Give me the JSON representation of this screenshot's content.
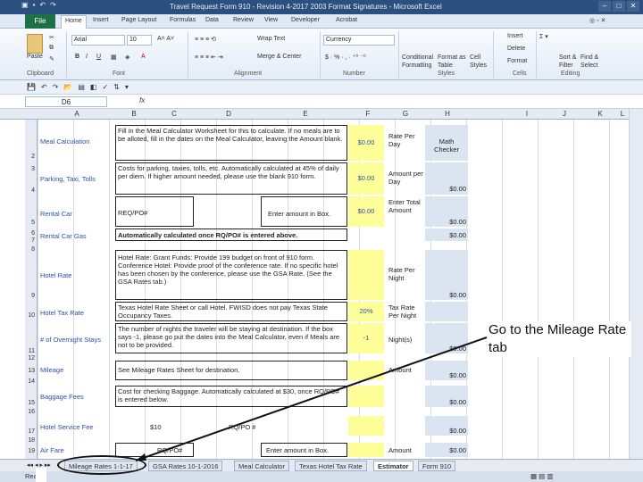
{
  "window": {
    "title": "Travel Request Form 910 - Revision 4-2017 2003 Format Signatures - Microsoft Excel"
  },
  "ribbon_tabs": [
    "File",
    "Home",
    "Insert",
    "Page Layout",
    "Formulas",
    "Data",
    "Review",
    "View",
    "Developer",
    "Acrobat"
  ],
  "ribbon": {
    "paste": "Paste",
    "font": "Arial",
    "size": "10",
    "wrap": "Wrap Text",
    "merge": "Merge & Center",
    "number_format": "Currency",
    "cond": "Conditional Formatting",
    "fmt_table": "Format as Table",
    "cell_styles": "Cell Styles",
    "insert": "Insert",
    "delete": "Delete",
    "format": "Format",
    "sort": "Sort & Filter",
    "find": "Find & Select",
    "groups": {
      "clipboard": "Clipboard",
      "font": "Font",
      "alignment": "Alignment",
      "number": "Number",
      "styles": "Styles",
      "cells": "Cells",
      "editing": "Editing"
    }
  },
  "formula_bar": {
    "name_box": "D6",
    "fx": "fx"
  },
  "columns": [
    "A",
    "B",
    "C",
    "D",
    "E",
    "F",
    "G",
    "H",
    "I",
    "J",
    "K",
    "L"
  ],
  "rows": [
    "2",
    "3",
    "4",
    "5",
    "6",
    "7",
    "8",
    "9",
    "10",
    "11",
    "12",
    "13",
    "14",
    "15",
    "16",
    "17",
    "18",
    "19",
    "20"
  ],
  "labels": {
    "meal": "Meal Calculation",
    "parking": "Parking, Taxi, Tolls",
    "rental_car": "Rental Car",
    "rental_gas": "Rental Car Gas",
    "hotel_rate": "Hotel Rate",
    "hotel_tax": "Hotel Tax Rate",
    "overnight": "# of Overnight Stays",
    "mileage": "Mileage",
    "baggage": "Baggage Fees",
    "hotel_fee": "Hotel Service Fee",
    "air": "Air Fare"
  },
  "desc": {
    "meal": "Fill in the Meal Calculator Worksheet for this to calculate. If no meals are to be alloted, fill in the dates on the Meal Calculator, leaving the Amount blank.",
    "parking": "Costs for parking, taxies, tolls, etc. Automatically calculated at 45% of daily per diem. If higher amount needed, please use the blank 910 form.",
    "rental": "REQ/PO#",
    "rental_enter": "Enter amount in Box.",
    "gas": "Automatically calculated once RQ/PO# is entered above.",
    "hotel": "Hotel Rate: Grant Funds: Provide 199 budget on front of 910 form. Conference Hotel: Provide proof of the conference rate. If no specific hotel has been chosen by the conference, please use the GSA Rate. (See the GSA Rates tab.)",
    "tax": "Texas Hotel Rate Sheet or call Hotel. FWISD does not pay Texas State Occupancy Taxes.",
    "overnight": "The number of nights the traveler will be staying at destination. If the box says -1, please go put the dates into the Meal Calculator, even if Meals are not to be provided.",
    "mileage": "See Mileage Rates Sheet for destination.",
    "baggage": "Cost for checking Baggage. Automatically calculated at $30, once RQ/PO# is entered below.",
    "hotel_fee_amt": "$10",
    "hotel_fee_po": "RQ/PO #",
    "air_po": "RQ/PO#",
    "air_enter": "Enter amount in Box."
  },
  "values": {
    "meal": "$0.00",
    "parking": "$0.00",
    "rental": "$0.00",
    "tax": "20%",
    "overnight": "-1",
    "g_meal": "Rate Per Day",
    "g_parking": "Amount per Day",
    "g_rental": "Enter Total Amount",
    "g_hotel": "Rate Per Night",
    "g_tax": "Tax Rate Per Night",
    "g_overnight": "Night(s)",
    "g_mileage": "Amount",
    "g_air": "Amount",
    "h_meal": "Math Checker",
    "h_zero": "$0.00"
  },
  "sheet_tabs": [
    "Mileage Rates 1-1-17",
    "GSA Rates 10-1-2016",
    "Meal Calculator",
    "Texas Hotel Tax Rate",
    "Estimator",
    "Form 910"
  ],
  "status": "Ready",
  "callout": "Go to the Mileage Rate tab"
}
